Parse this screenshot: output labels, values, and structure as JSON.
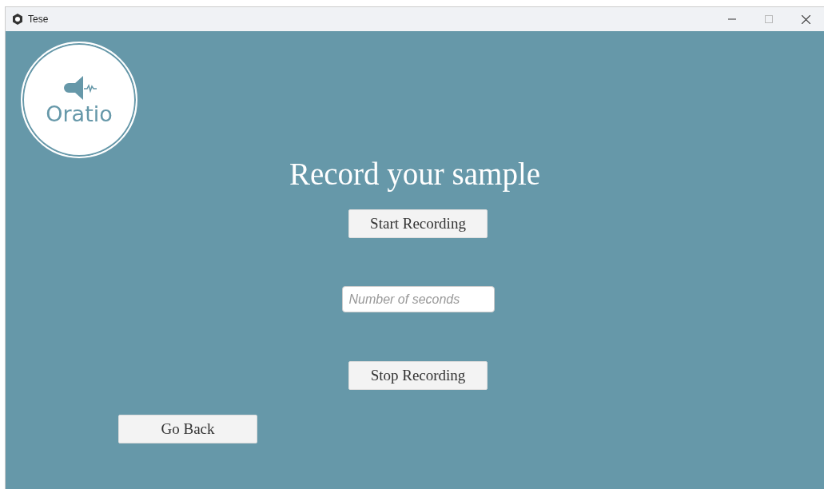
{
  "window": {
    "title": "Tese"
  },
  "logo": {
    "text": "Oratio"
  },
  "heading": "Record your sample",
  "start_button": "Start Recording",
  "seconds_field": {
    "placeholder": "Number of seconds"
  },
  "stop_button": "Stop Recording",
  "back_button": "Go Back"
}
